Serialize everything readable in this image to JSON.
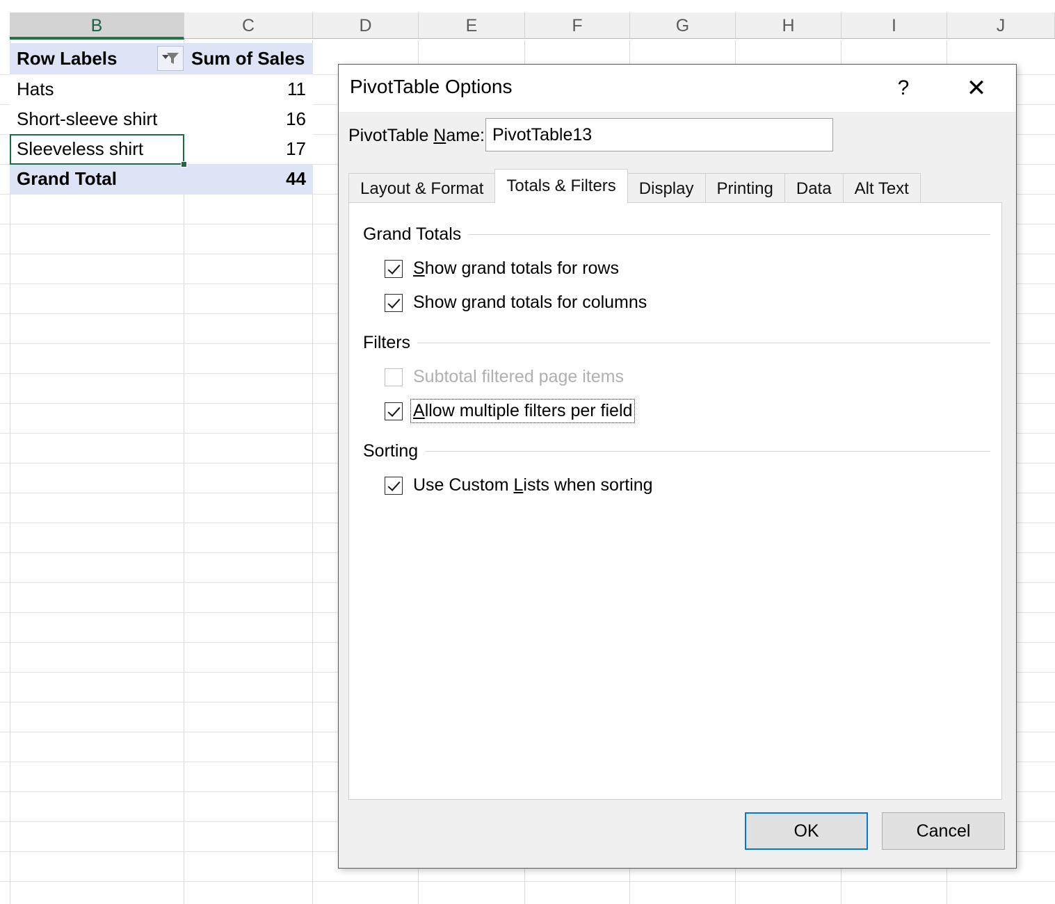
{
  "spreadsheet": {
    "column_headers": [
      "B",
      "C",
      "D",
      "E",
      "F",
      "G",
      "H",
      "I",
      "J"
    ],
    "active_column": "B",
    "pivot_table": {
      "header": {
        "row_labels": "Row Labels",
        "filter_icon": "filter-dropdown-icon",
        "value_header": "Sum of Sales"
      },
      "rows": [
        {
          "label": "Hats",
          "value": "11"
        },
        {
          "label": "Short-sleeve shirt",
          "value": "16"
        },
        {
          "label": "Sleeveless shirt",
          "value": "17"
        }
      ],
      "grand_total": {
        "label": "Grand Total",
        "value": "44"
      }
    },
    "selected_cell_label": "Sleeveless shirt"
  },
  "dialog": {
    "title": "PivotTable Options",
    "help_icon": "?",
    "close_icon": "✕",
    "name_field": {
      "label_prefix": "PivotTable ",
      "label_accel": "N",
      "label_suffix": "ame:",
      "value": "PivotTable13"
    },
    "tabs": [
      {
        "label": "Layout & Format",
        "active": false
      },
      {
        "label": "Totals & Filters",
        "active": true
      },
      {
        "label": "Display",
        "active": false
      },
      {
        "label": "Printing",
        "active": false
      },
      {
        "label": "Data",
        "active": false
      },
      {
        "label": "Alt Text",
        "active": false
      }
    ],
    "groups": {
      "grand_totals": {
        "title": "Grand Totals",
        "options": [
          {
            "pre": "",
            "accel": "S",
            "post": "how grand totals for rows",
            "checked": true,
            "enabled": true,
            "focused": false
          },
          {
            "pre": "Show ",
            "accel": "g",
            "post": "rand totals for columns",
            "checked": true,
            "enabled": true,
            "focused": false
          }
        ]
      },
      "filters": {
        "title": "Filters",
        "options": [
          {
            "pre": "",
            "accel": "",
            "post": "Subtotal filtered page items",
            "checked": false,
            "enabled": false,
            "focused": false
          },
          {
            "pre": "",
            "accel": "A",
            "post": "llow multiple filters per field",
            "checked": true,
            "enabled": true,
            "focused": true
          }
        ]
      },
      "sorting": {
        "title": "Sorting",
        "options": [
          {
            "pre": "Use Custom ",
            "accel": "L",
            "post": "ists when sorting",
            "checked": true,
            "enabled": true,
            "focused": false
          }
        ]
      }
    },
    "buttons": {
      "ok": "OK",
      "cancel": "Cancel"
    }
  },
  "colors": {
    "excel_green": "#217346",
    "pivot_header_fill": "#dce4f5",
    "selection_border": "#1b6a41",
    "focus_blue": "#0078d7"
  }
}
